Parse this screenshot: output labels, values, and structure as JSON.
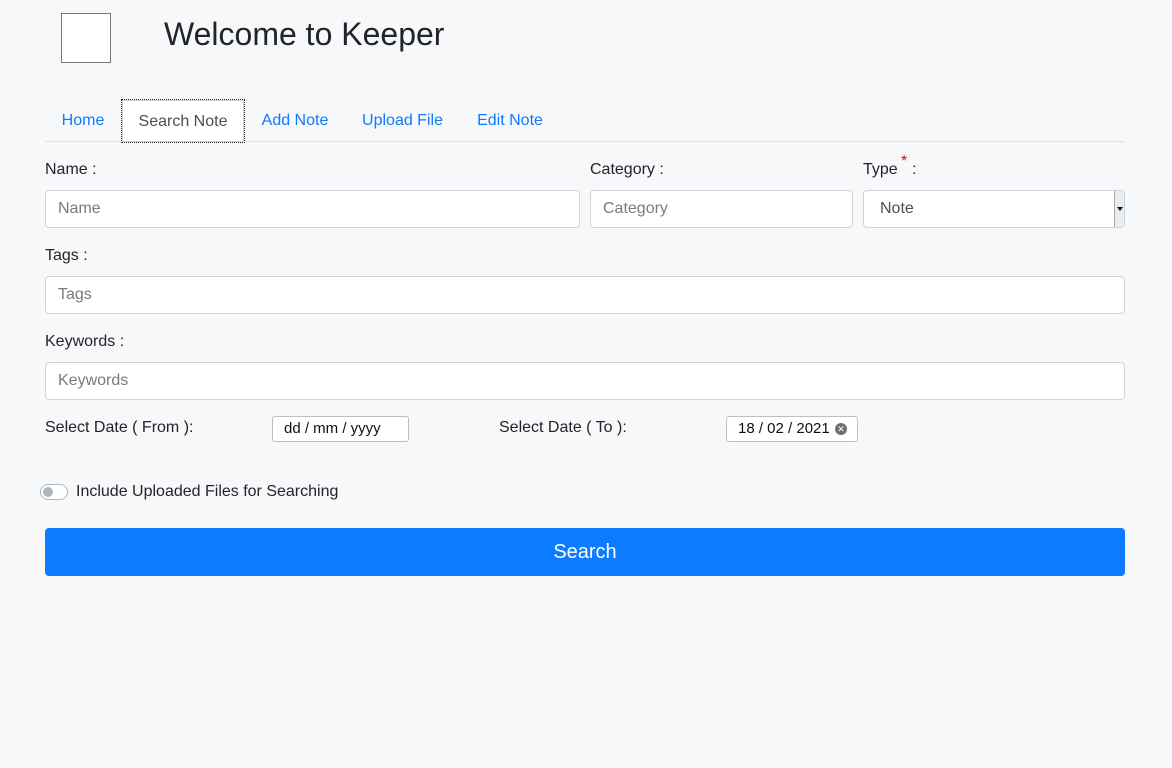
{
  "header": {
    "title": "Welcome to Keeper"
  },
  "tabs": [
    {
      "label": "Home",
      "active": false
    },
    {
      "label": "Search Note",
      "active": true
    },
    {
      "label": "Add Note",
      "active": false
    },
    {
      "label": "Upload File",
      "active": false
    },
    {
      "label": "Edit Note",
      "active": false
    }
  ],
  "form": {
    "name": {
      "label": "Name :",
      "placeholder": "Name",
      "value": ""
    },
    "category": {
      "label": "Category :",
      "placeholder": "Category",
      "value": ""
    },
    "type": {
      "label": "Type",
      "required_mark": "*",
      "colon": ":",
      "value": "Note"
    },
    "tags": {
      "label": "Tags :",
      "placeholder": "Tags",
      "value": ""
    },
    "keywords": {
      "label": "Keywords :",
      "placeholder": "Keywords",
      "value": ""
    },
    "date_from": {
      "label": "Select Date ( From ):",
      "value": "dd / mm / yyyy"
    },
    "date_to": {
      "label": "Select Date ( To ):",
      "value": "18 / 02 / 2021"
    },
    "include_files": {
      "label": "Include Uploaded Files for Searching",
      "checked": false
    },
    "search_button": "Search"
  },
  "colors": {
    "accent": "#0d7bff",
    "required": "#ee0000"
  }
}
